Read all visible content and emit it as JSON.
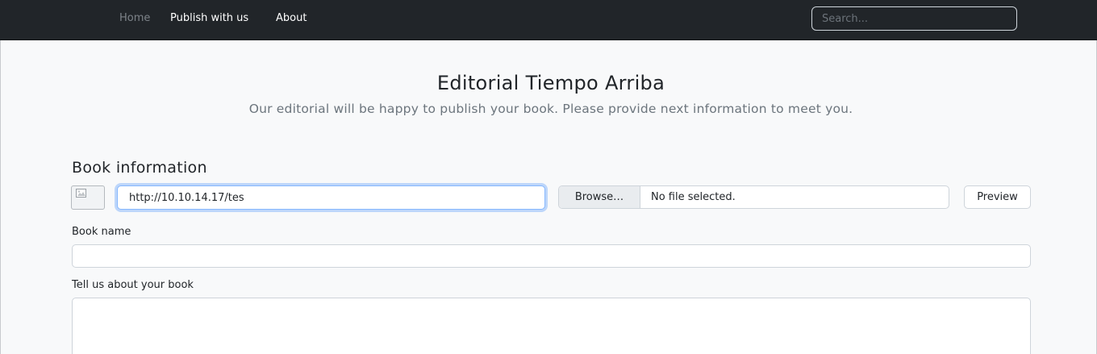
{
  "nav": {
    "items": [
      {
        "label": "Home",
        "muted": true
      },
      {
        "label": "Publish with us",
        "muted": false
      },
      {
        "label": "About",
        "muted": false
      }
    ],
    "search_placeholder": "Search...",
    "search_value": ""
  },
  "header": {
    "title": "Editorial Tiempo Arriba",
    "subtitle": "Our editorial will be happy to publish your book. Please provide next information to meet you."
  },
  "book_info": {
    "section_title": "Book information",
    "cover_icon": "broken-image-icon",
    "url_value": "http://10.10.14.17/tes",
    "browse_label": "Browse…",
    "file_status": "No file selected.",
    "preview_label": "Preview",
    "name_label": "Book name",
    "name_value": "",
    "about_label": "Tell us about your book",
    "about_value": ""
  },
  "colors": {
    "navbar_bg": "#212529",
    "page_bg": "#f8f9fa",
    "focus_border": "#86b7fe",
    "muted_text": "#6c757d"
  }
}
